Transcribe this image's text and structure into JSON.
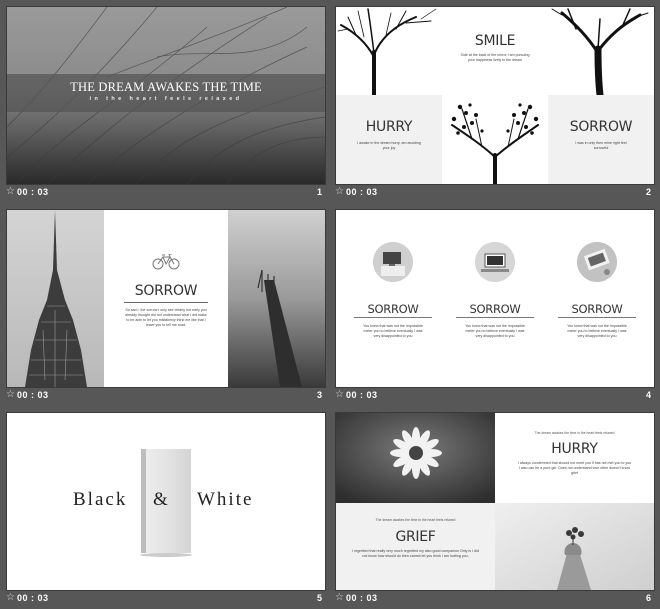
{
  "slides": [
    {
      "number": "1",
      "duration": "00 : 03",
      "title": "THE DREAM AWAKES THE TIME",
      "subtitle": "in the heart feels relaxed"
    },
    {
      "number": "2",
      "duration": "00 : 03",
      "smile": "SMILE",
      "smile_text": "Side at the back of the mirror I am pursuing your happiness lively in the dream",
      "hurry": "HURRY",
      "hurry_text": "I awake in the dream hurry, am avoiding your joy",
      "sorrow": "SORROW",
      "sorrow_text": "I was in only then mine right feel sorrowful"
    },
    {
      "number": "3",
      "duration": "00 : 03",
      "heading": "SORROW",
      "text": "So sad I, the sorrow I only see clearly not early you already thought did not understand what I did make to be able to let you mistakenly think me like that I leave you to tell me road."
    },
    {
      "number": "4",
      "duration": "00 : 03",
      "items": [
        {
          "heading": "SORROW",
          "text": "You knew that was not the impossible meter you to believe eventually I was very disappointed to you"
        },
        {
          "heading": "SORROW",
          "text": "You knew that was not the impossible meter you to believe eventually I was very disappointed to you"
        },
        {
          "heading": "SORROW",
          "text": "You knew that was not the impossible meter you to believe eventually I was very disappointed to you"
        }
      ]
    },
    {
      "number": "5",
      "duration": "00 : 03",
      "word1": "Black",
      "amp": "&",
      "word2": "White"
    },
    {
      "number": "6",
      "duration": "00 : 03",
      "hurry_small": "The dream awakes the time in the heart feels relaxed",
      "hurry": "HURRY",
      "hurry_text": "I always condemned that should not meet you if has not met you to you I also can be a pure girl. Does not understand love often doesn't know grief",
      "grief_small": "The dream awakes the time in the heart feels relaxed",
      "grief": "GRIEF",
      "grief_text": "I regretted that really very much regretted my also good companion Only is I did not know how should do then cannot let you think I am hurting you."
    }
  ],
  "icons": {
    "duration": "star-icon",
    "bicycle": "bicycle-icon"
  }
}
